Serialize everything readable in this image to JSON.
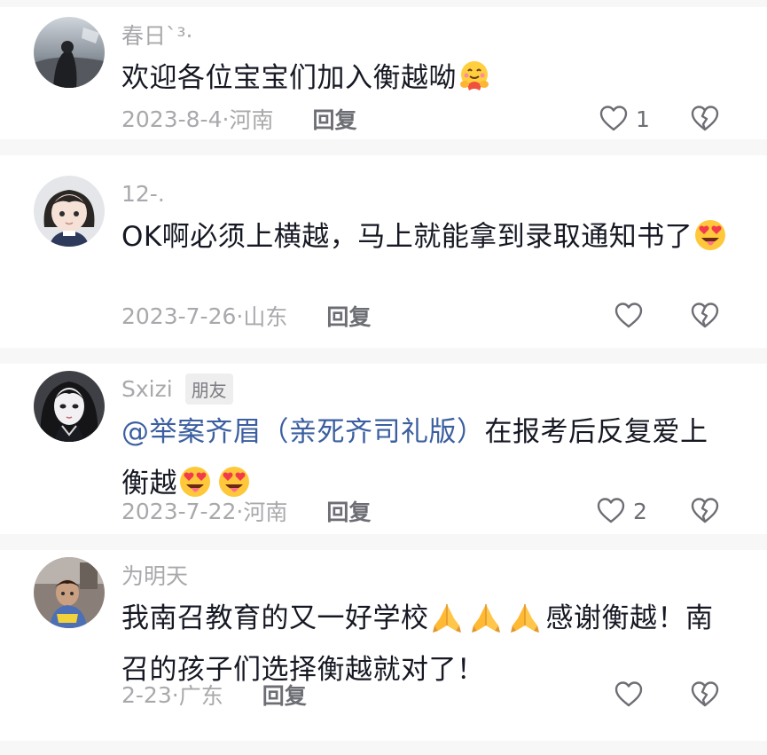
{
  "comments": [
    {
      "username": "春日`³·",
      "badge": "",
      "segments": [
        {
          "t": "text",
          "v": "欢迎各位宝宝们加入衡越呦"
        },
        {
          "t": "emoji",
          "icon": "hugging-face-emoji"
        }
      ],
      "date": "2023-8-4",
      "location": "河南",
      "reply_label": "回复",
      "likes": "1"
    },
    {
      "username": "12-.",
      "badge": "",
      "segments": [
        {
          "t": "text",
          "v": "OK啊必须上横越，马上就能拿到录取通知书了"
        },
        {
          "t": "emoji",
          "icon": "heart-eyes-tongue-emoji"
        }
      ],
      "date": "2023-7-26",
      "location": "山东",
      "reply_label": "回复",
      "likes": ""
    },
    {
      "username": "Sxizi",
      "badge": "朋友",
      "segments": [
        {
          "t": "mention",
          "v": "@举案齐眉（亲死齐司礼版）"
        },
        {
          "t": "text",
          "v": "在报考后反复爱上衡越"
        },
        {
          "t": "emoji",
          "icon": "heart-eyes-tongue-emoji"
        },
        {
          "t": "emoji",
          "icon": "heart-eyes-tongue-emoji"
        }
      ],
      "date": "2023-7-22",
      "location": "河南",
      "reply_label": "回复",
      "likes": "2"
    },
    {
      "username": "为明天",
      "badge": "",
      "segments": [
        {
          "t": "text",
          "v": "我南召教育的又一好学校"
        },
        {
          "t": "emoji",
          "icon": "folded-hands-emoji"
        },
        {
          "t": "emoji",
          "icon": "folded-hands-emoji"
        },
        {
          "t": "emoji",
          "icon": "folded-hands-emoji"
        },
        {
          "t": "text",
          "v": "感谢衡越！南召的孩子们选择衡越就对了！"
        }
      ],
      "date": "2-23",
      "location": "广东",
      "reply_label": "回复",
      "likes": ""
    }
  ],
  "colors": {
    "text_primary": "#161823",
    "text_secondary": "#a9a9ad",
    "mention": "#3b5fa0",
    "separator": "#f7f7f7"
  }
}
